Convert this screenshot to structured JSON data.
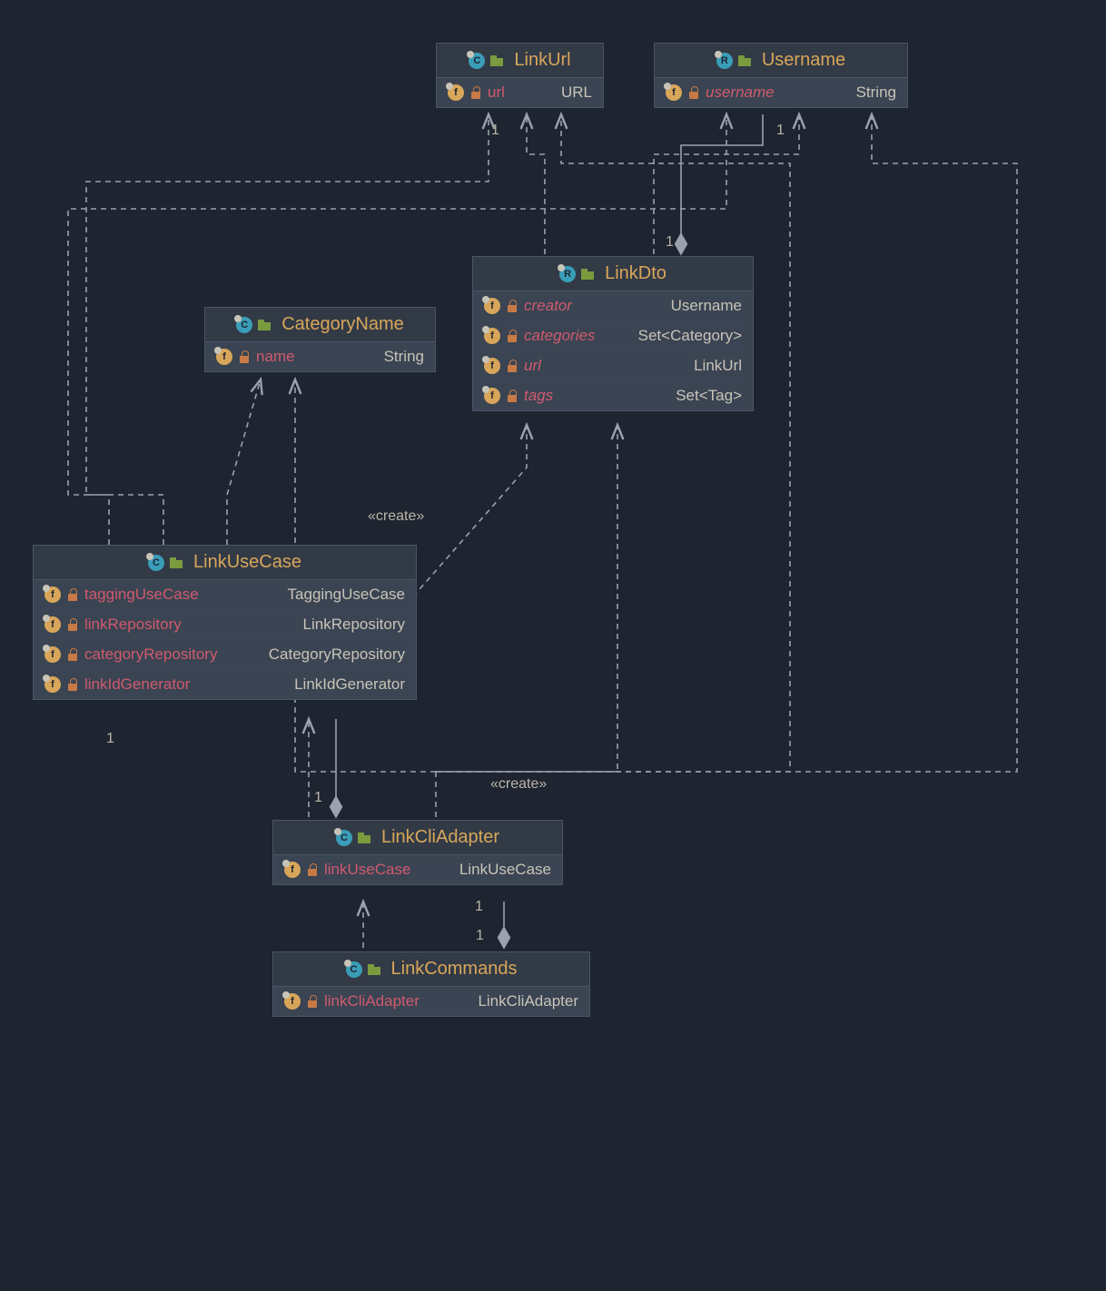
{
  "classes": {
    "LinkUrl": {
      "kind": "C",
      "name": "LinkUrl",
      "fields": [
        {
          "name": "url",
          "type": "URL",
          "italic": false
        }
      ]
    },
    "Username": {
      "kind": "R",
      "name": "Username",
      "fields": [
        {
          "name": "username",
          "type": "String",
          "italic": true
        }
      ]
    },
    "CategoryName": {
      "kind": "C",
      "name": "CategoryName",
      "fields": [
        {
          "name": "name",
          "type": "String",
          "italic": false
        }
      ]
    },
    "LinkDto": {
      "kind": "R",
      "name": "LinkDto",
      "fields": [
        {
          "name": "creator",
          "type": "Username",
          "italic": true
        },
        {
          "name": "categories",
          "type": "Set<Category>",
          "italic": true
        },
        {
          "name": "url",
          "type": "LinkUrl",
          "italic": true
        },
        {
          "name": "tags",
          "type": "Set<Tag>",
          "italic": true
        }
      ]
    },
    "LinkUseCase": {
      "kind": "C",
      "name": "LinkUseCase",
      "fields": [
        {
          "name": "taggingUseCase",
          "type": "TaggingUseCase",
          "italic": false
        },
        {
          "name": "linkRepository",
          "type": "LinkRepository",
          "italic": false
        },
        {
          "name": "categoryRepository",
          "type": "CategoryRepository",
          "italic": false
        },
        {
          "name": "linkIdGenerator",
          "type": "LinkIdGenerator",
          "italic": false
        }
      ]
    },
    "LinkCliAdapter": {
      "kind": "C",
      "name": "LinkCliAdapter",
      "fields": [
        {
          "name": "linkUseCase",
          "type": "LinkUseCase",
          "italic": false
        }
      ]
    },
    "LinkCommands": {
      "kind": "C",
      "name": "LinkCommands",
      "fields": [
        {
          "name": "linkCliAdapter",
          "type": "LinkCliAdapter",
          "italic": false
        }
      ]
    }
  },
  "stereotypes": {
    "create1": "«create»",
    "create2": "«create»"
  },
  "multiplicities": {
    "m1": "1",
    "m2": "1",
    "m3": "1",
    "m4": "1",
    "m5": "1",
    "m6": "1",
    "m7": "1"
  },
  "connectors": [
    {
      "from": "LinkCommands",
      "to": "LinkCliAdapter",
      "kind": "composition",
      "mult": [
        "1",
        "1"
      ]
    },
    {
      "from": "LinkCommands",
      "to": "LinkCliAdapter",
      "kind": "dependency"
    },
    {
      "from": "LinkCliAdapter",
      "to": "LinkUseCase",
      "kind": "composition",
      "mult": [
        "1",
        "1"
      ]
    },
    {
      "from": "LinkCliAdapter",
      "to": "LinkUseCase",
      "kind": "dependency"
    },
    {
      "from": "LinkCliAdapter",
      "to": "LinkDto",
      "kind": "dependency",
      "stereotype": "«create»"
    },
    {
      "from": "LinkCliAdapter",
      "to": "CategoryName",
      "kind": "dependency"
    },
    {
      "from": "LinkCliAdapter",
      "to": "LinkUrl",
      "kind": "dependency"
    },
    {
      "from": "LinkCliAdapter",
      "to": "Username",
      "kind": "dependency"
    },
    {
      "from": "LinkUseCase",
      "to": "LinkDto",
      "kind": "dependency",
      "stereotype": "«create»"
    },
    {
      "from": "LinkUseCase",
      "to": "CategoryName",
      "kind": "dependency"
    },
    {
      "from": "LinkUseCase",
      "to": "LinkUrl",
      "kind": "dependency"
    },
    {
      "from": "LinkUseCase",
      "to": "Username",
      "kind": "dependency"
    },
    {
      "from": "LinkDto",
      "to": "Username",
      "kind": "composition",
      "mult": [
        "1",
        "1"
      ]
    },
    {
      "from": "LinkDto",
      "to": "LinkUrl",
      "kind": "dependency"
    },
    {
      "from": "LinkDto",
      "to": "Username",
      "kind": "dependency"
    }
  ]
}
